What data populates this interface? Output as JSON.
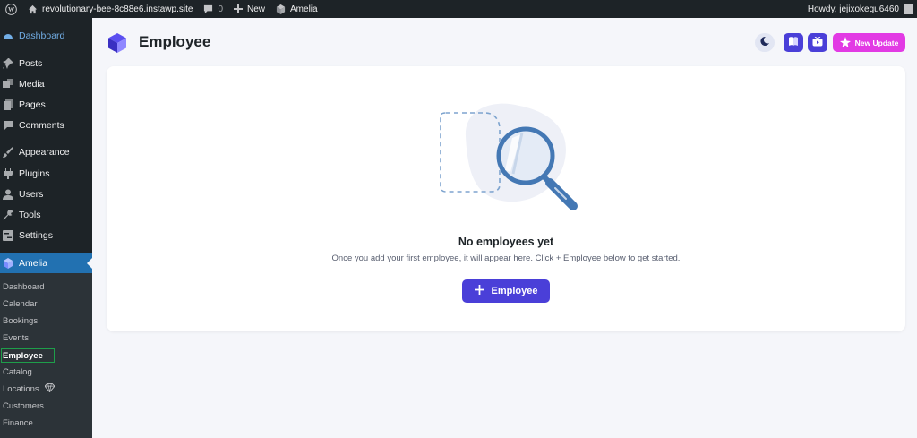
{
  "adminbar": {
    "site_name": "revolutionary-bee-8c88e6.instawp.site",
    "comments_count": "0",
    "new_label": "New",
    "plugin_label": "Amelia",
    "howdy": "Howdy, jejixokegu6460"
  },
  "sidebar": {
    "items": [
      {
        "label": "Dashboard",
        "icon": "dashboard-icon"
      },
      {
        "label": "Posts",
        "icon": "pin-icon"
      },
      {
        "label": "Media",
        "icon": "media-icon"
      },
      {
        "label": "Pages",
        "icon": "pages-icon"
      },
      {
        "label": "Comments",
        "icon": "comment-icon"
      },
      {
        "label": "Appearance",
        "icon": "brush-icon"
      },
      {
        "label": "Plugins",
        "icon": "plugin-icon"
      },
      {
        "label": "Users",
        "icon": "users-icon"
      },
      {
        "label": "Tools",
        "icon": "wrench-icon"
      },
      {
        "label": "Settings",
        "icon": "settings-icon"
      },
      {
        "label": "Amelia",
        "icon": "amelia-logo-icon"
      }
    ],
    "submenu": [
      "Dashboard",
      "Calendar",
      "Bookings",
      "Events",
      "Employee",
      "Catalog",
      "Locations",
      "Customers",
      "Finance"
    ]
  },
  "header": {
    "title": "Employee",
    "new_update_label": "New Update"
  },
  "empty_state": {
    "title": "No employees yet",
    "description": "Once you add your first employee, it will appear here. Click + Employee below to get started.",
    "button_label": "Employee"
  },
  "colors": {
    "admin_dark": "#1d2327",
    "accent_blue": "#2271b1",
    "primary_purple": "#4a3fd8",
    "update_pink": "#e23ae4"
  }
}
